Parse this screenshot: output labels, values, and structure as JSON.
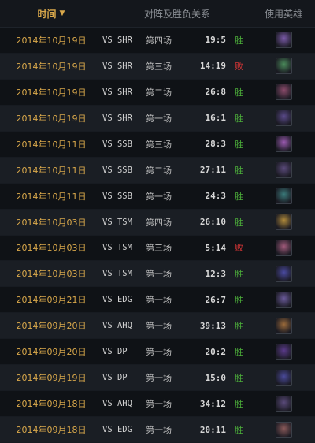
{
  "header": {
    "time_label": "时间",
    "matchup_label": "对阵及胜负关系",
    "hero_label": "使用英雄"
  },
  "matches": [
    {
      "date": "2014年10月19日",
      "opponent": "VS SHR",
      "game": "第四场",
      "score": "19:5",
      "result": "胜",
      "win": true,
      "hero_color": "#7a5aa8"
    },
    {
      "date": "2014年10月19日",
      "opponent": "VS SHR",
      "game": "第三场",
      "score": "14:19",
      "result": "败",
      "win": false,
      "hero_color": "#4a8a5a"
    },
    {
      "date": "2014年10月19日",
      "opponent": "VS SHR",
      "game": "第二场",
      "score": "26:8",
      "result": "胜",
      "win": true,
      "hero_color": "#8a4a6a"
    },
    {
      "date": "2014年10月19日",
      "opponent": "VS SHR",
      "game": "第一场",
      "score": "16:1",
      "result": "胜",
      "win": true,
      "hero_color": "#5a4a8a"
    },
    {
      "date": "2014年10月11日",
      "opponent": "VS SSB",
      "game": "第三场",
      "score": "28:3",
      "result": "胜",
      "win": true,
      "hero_color": "#9a5ab0"
    },
    {
      "date": "2014年10月11日",
      "opponent": "VS SSB",
      "game": "第二场",
      "score": "27:11",
      "result": "胜",
      "win": true,
      "hero_color": "#5a4a7a"
    },
    {
      "date": "2014年10月11日",
      "opponent": "VS SSB",
      "game": "第一场",
      "score": "24:3",
      "result": "胜",
      "win": true,
      "hero_color": "#3a7a7a"
    },
    {
      "date": "2014年10月03日",
      "opponent": "VS TSM",
      "game": "第四场",
      "score": "26:10",
      "result": "胜",
      "win": true,
      "hero_color": "#b08a3a"
    },
    {
      "date": "2014年10月03日",
      "opponent": "VS TSM",
      "game": "第三场",
      "score": "5:14",
      "result": "败",
      "win": false,
      "hero_color": "#a05a7a"
    },
    {
      "date": "2014年10月03日",
      "opponent": "VS TSM",
      "game": "第一场",
      "score": "12:3",
      "result": "胜",
      "win": true,
      "hero_color": "#4a4aa0"
    },
    {
      "date": "2014年09月21日",
      "opponent": "VS EDG",
      "game": "第一场",
      "score": "26:7",
      "result": "胜",
      "win": true,
      "hero_color": "#6a5a9a"
    },
    {
      "date": "2014年09月20日",
      "opponent": "VS AHQ",
      "game": "第一场",
      "score": "39:13",
      "result": "胜",
      "win": true,
      "hero_color": "#9a6a3a"
    },
    {
      "date": "2014年09月20日",
      "opponent": "VS DP",
      "game": "第一场",
      "score": "20:2",
      "result": "胜",
      "win": true,
      "hero_color": "#5a3a8a"
    },
    {
      "date": "2014年09月19日",
      "opponent": "VS DP",
      "game": "第一场",
      "score": "15:0",
      "result": "胜",
      "win": true,
      "hero_color": "#4a4a9a"
    },
    {
      "date": "2014年09月18日",
      "opponent": "VS AHQ",
      "game": "第一场",
      "score": "34:12",
      "result": "胜",
      "win": true,
      "hero_color": "#5a4a7a"
    },
    {
      "date": "2014年09月18日",
      "opponent": "VS EDG",
      "game": "第一场",
      "score": "20:11",
      "result": "胜",
      "win": true,
      "hero_color": "#8a5a5a"
    }
  ]
}
